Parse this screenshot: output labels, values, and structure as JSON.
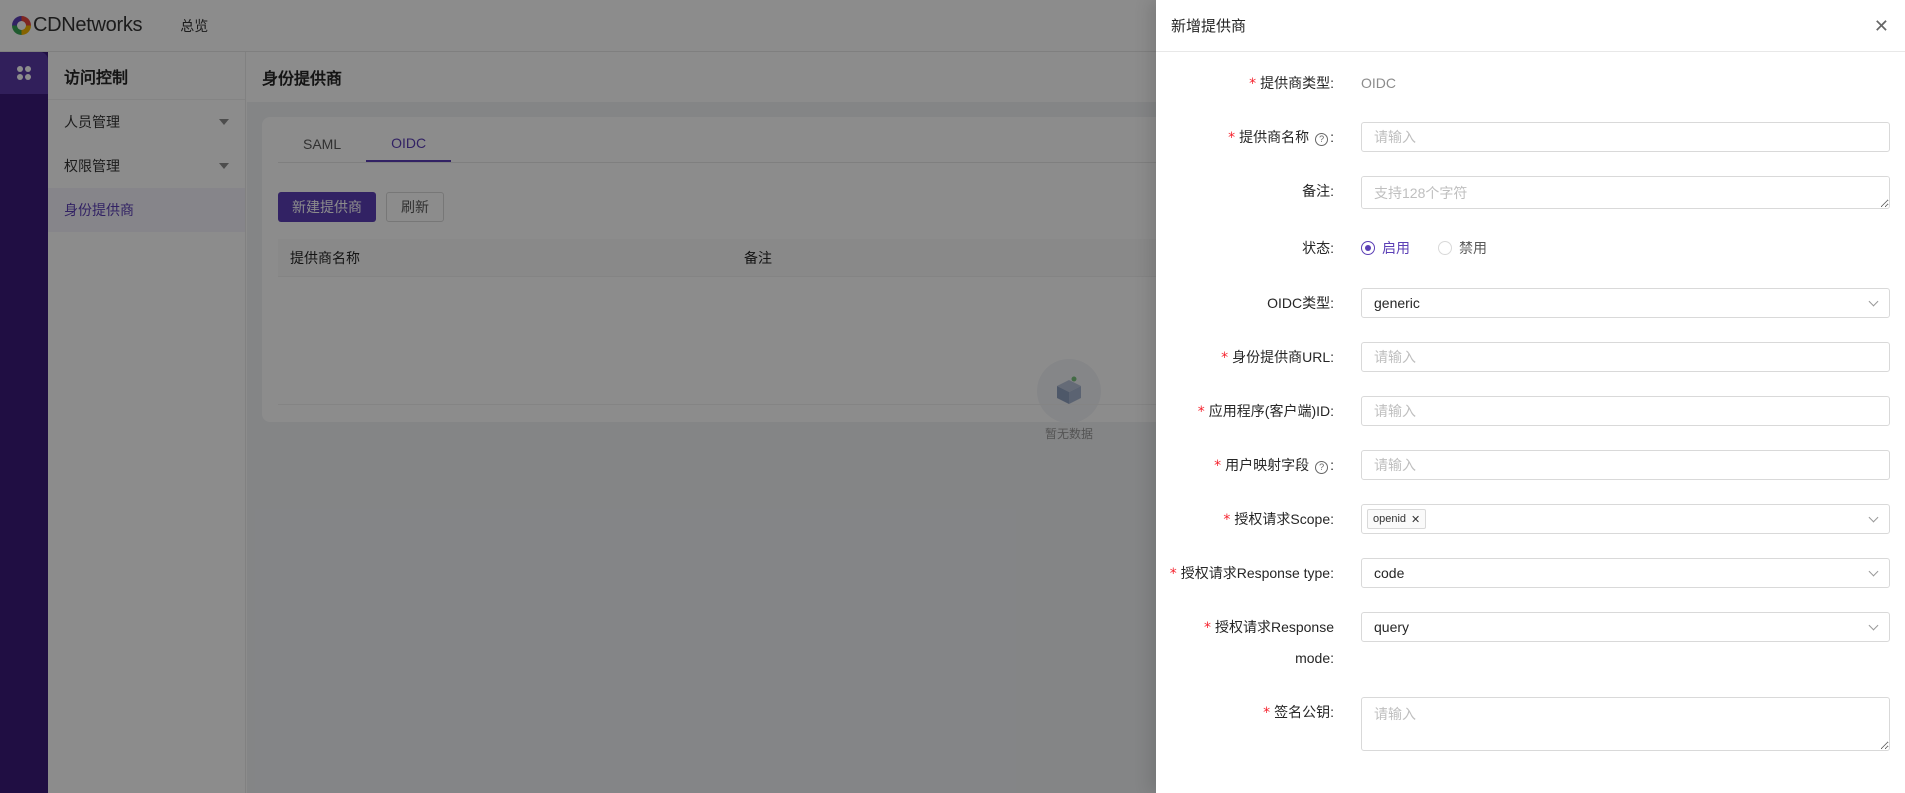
{
  "app": {
    "brand": "CDNetworks",
    "top_nav": "总览"
  },
  "sidenav": {
    "title": "访问控制",
    "items": [
      {
        "label": "人员管理",
        "expandable": true
      },
      {
        "label": "权限管理",
        "expandable": true
      },
      {
        "label": "身份提供商",
        "active": true
      }
    ]
  },
  "main": {
    "page_title": "身份提供商",
    "tabs": [
      {
        "label": "SAML",
        "active": false
      },
      {
        "label": "OIDC",
        "active": true
      }
    ],
    "buttons": {
      "new_provider": "新建提供商",
      "refresh": "刷新"
    },
    "table": {
      "columns": [
        "提供商名称",
        "备注"
      ],
      "empty_text": "暂无数据"
    }
  },
  "drawer": {
    "title": "新增提供商",
    "close_icon": "close-icon",
    "fields": {
      "provider_type": {
        "label": "提供商类型:",
        "value": "OIDC"
      },
      "provider_name": {
        "label": "提供商名称",
        "suffix": ":",
        "placeholder": "请输入"
      },
      "remark": {
        "label": "备注:",
        "placeholder": "支持128个字符"
      },
      "status": {
        "label": "状态:",
        "options": [
          "启用",
          "禁用"
        ],
        "selected": "启用"
      },
      "oidc_type": {
        "label": "OIDC类型:",
        "value": "generic"
      },
      "idp_url": {
        "label": "身份提供商URL:",
        "placeholder": "请输入"
      },
      "client_id": {
        "label": "应用程序(客户端)ID:",
        "placeholder": "请输入"
      },
      "user_mapping": {
        "label": "用户映射字段",
        "suffix": ":",
        "placeholder": "请输入"
      },
      "scope": {
        "label": "授权请求Scope:",
        "tags": [
          "openid"
        ]
      },
      "response_type": {
        "label": "授权请求Response type:",
        "value": "code"
      },
      "response_mode": {
        "label_line1": "授权请求Response",
        "label_line2": "mode:",
        "value": "query"
      },
      "sign_key": {
        "label": "签名公钥:",
        "placeholder": "请输入"
      }
    }
  },
  "colors": {
    "brand_purple": "#5b3fb6",
    "rail": "#3b1a7a",
    "required": "#f5222d"
  }
}
